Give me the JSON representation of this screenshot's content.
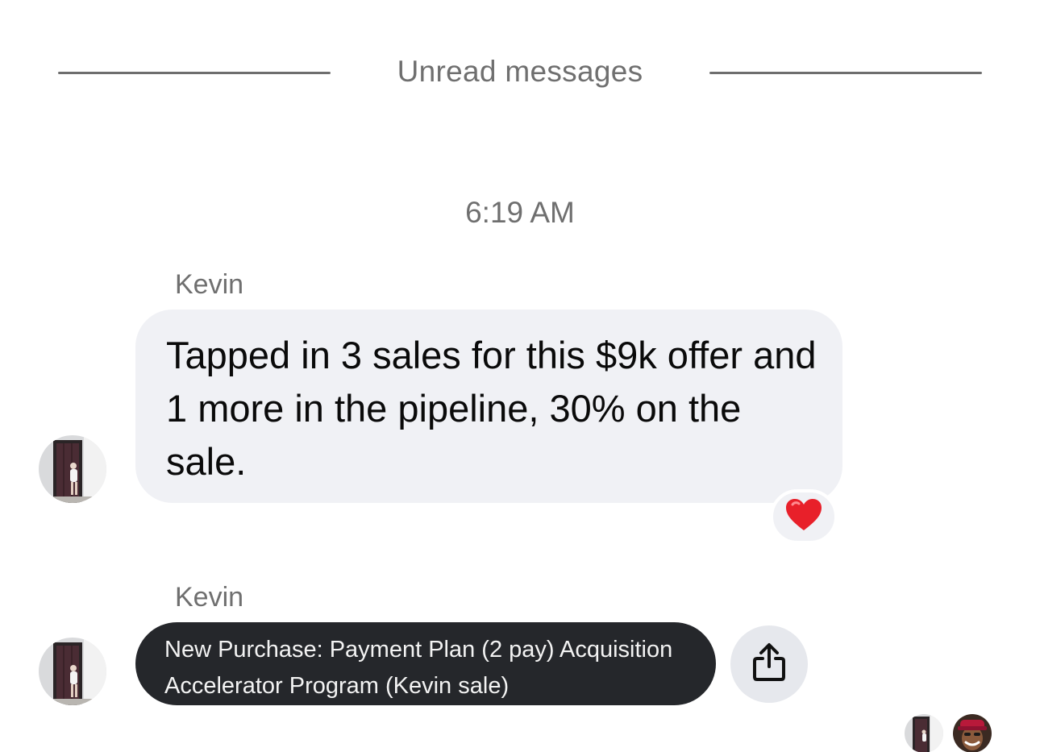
{
  "divider": {
    "label": "Unread messages"
  },
  "timestamp": "6:19 AM",
  "messages": [
    {
      "sender": "Kevin",
      "text": "Tapped in 3 sales for this $9k offer and 1 more in the pipeline, 30% on the sale.",
      "reaction": "heart-icon"
    },
    {
      "sender": "Kevin",
      "text": "New Purchase: Payment Plan (2 pay) Acquisition Accelerator Program (Kevin sale)",
      "action": "share-icon"
    }
  ],
  "colors": {
    "bubble_light": "#f0f1f5",
    "bubble_dark": "#25272b",
    "heart": "#e8202a",
    "muted_text": "#6f6f6f"
  }
}
